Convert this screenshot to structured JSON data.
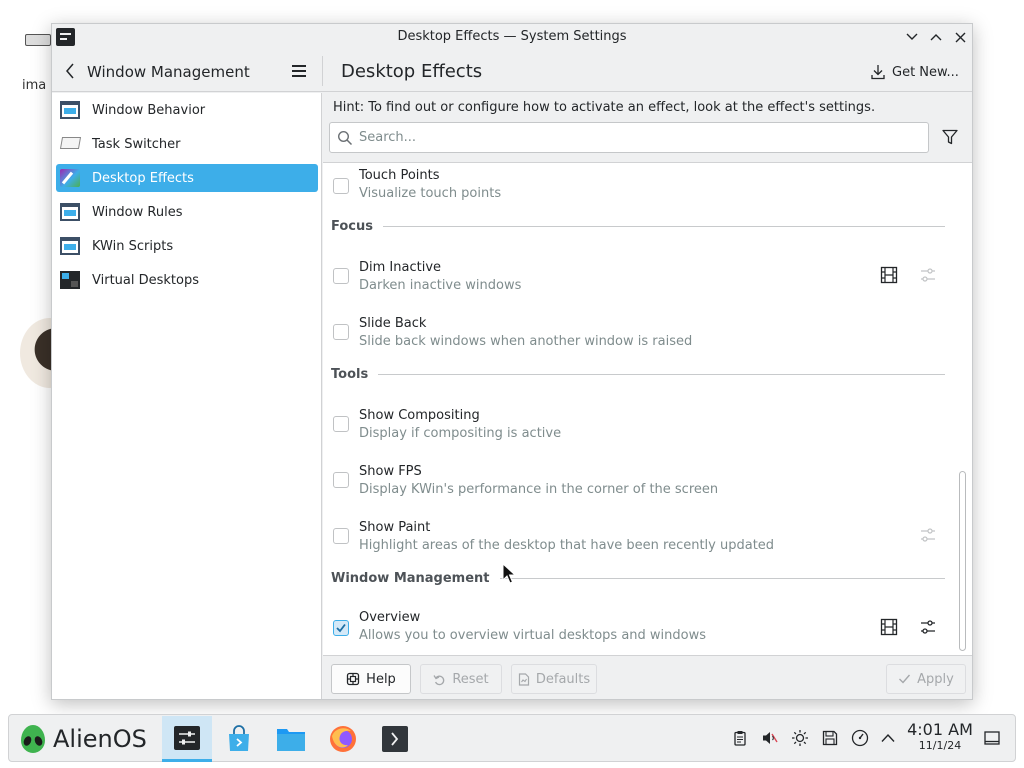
{
  "desktop": {
    "text_fragment": "ima"
  },
  "window": {
    "title": "Desktop Effects — System Settings"
  },
  "header": {
    "sidebar_title": "Window Management",
    "page_title": "Desktop Effects",
    "get_new_label": "Get New..."
  },
  "sidebar": {
    "items": [
      {
        "label": "Window Behavior",
        "icon": "window-icon"
      },
      {
        "label": "Task Switcher",
        "icon": "task-switcher-icon"
      },
      {
        "label": "Desktop Effects",
        "icon": "desktop-effects-icon",
        "active": true
      },
      {
        "label": "Window Rules",
        "icon": "window-icon"
      },
      {
        "label": "KWin Scripts",
        "icon": "window-icon"
      },
      {
        "label": "Virtual Desktops",
        "icon": "virtual-desktops-icon"
      }
    ]
  },
  "content": {
    "hint": "Hint: To find out or configure how to activate an effect, look at the effect's settings.",
    "search": {
      "placeholder": "Search...",
      "value": ""
    },
    "sections": {
      "focus": "Focus",
      "tools": "Tools",
      "window_management": "Window Management"
    },
    "effects": {
      "touch_points": {
        "name": "Touch Points",
        "description": "Visualize touch points",
        "checked": false
      },
      "dim_inactive": {
        "name": "Dim Inactive",
        "description": "Darken inactive windows",
        "checked": false
      },
      "slide_back": {
        "name": "Slide Back",
        "description": "Slide back windows when another window is raised",
        "checked": false
      },
      "show_compositing": {
        "name": "Show Compositing",
        "description": "Display if compositing is active",
        "checked": false
      },
      "show_fps": {
        "name": "Show FPS",
        "description": "Display KWin's performance in the corner of the screen",
        "checked": false
      },
      "show_paint": {
        "name": "Show Paint",
        "description": "Highlight areas of the desktop that have been recently updated",
        "checked": false
      },
      "overview": {
        "name": "Overview",
        "description": "Allows you to overview virtual desktops and windows",
        "checked": true
      }
    }
  },
  "footer": {
    "help": "Help",
    "reset": "Reset",
    "defaults": "Defaults",
    "apply": "Apply"
  },
  "taskbar": {
    "launcher_label": "AlienOS",
    "clock_time": "4:01 AM",
    "clock_date": "11/1/24"
  },
  "colors": {
    "accent": "#3daee9",
    "window_bg": "#eff0f1",
    "text": "#232629",
    "muted_text": "#7f8c8d"
  }
}
